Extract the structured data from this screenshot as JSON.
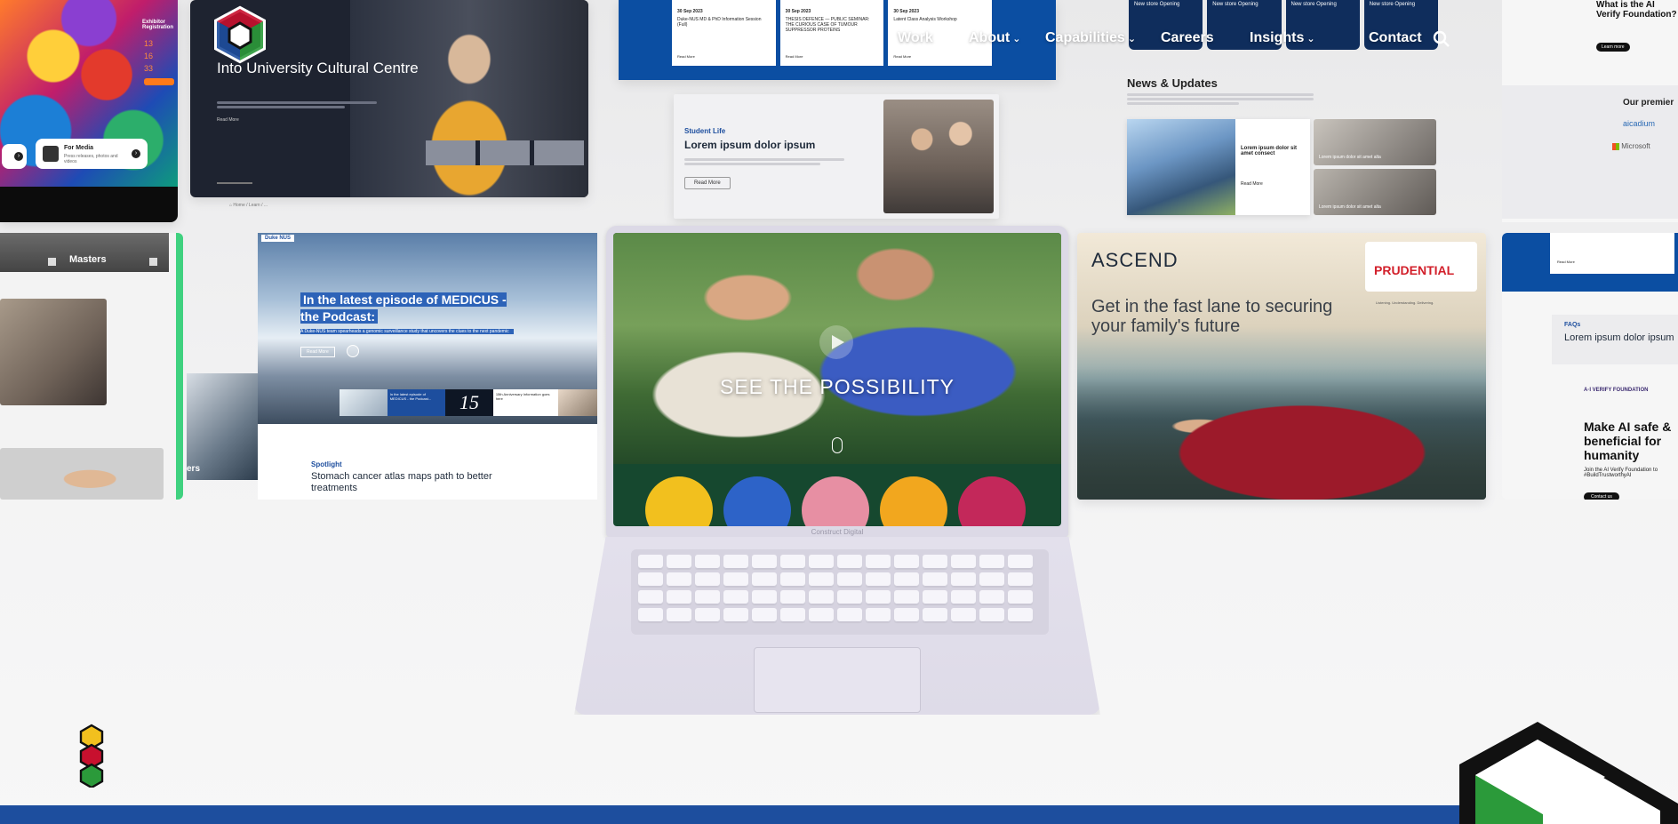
{
  "nav": {
    "items": [
      {
        "label": "Work"
      },
      {
        "label": "About"
      },
      {
        "label": "Capabilities"
      },
      {
        "label": "Careers"
      },
      {
        "label": "Insights"
      },
      {
        "label": "Contact"
      }
    ],
    "search_icon": "search-icon",
    "brand_colors": [
      "#c8102e",
      "#1d4e9e",
      "#2b9a3a",
      "#f2c01e",
      "#111111"
    ]
  },
  "hero": {
    "tagline": "SEE THE POSSIBILITY",
    "laptop_brand": "Construct Digital"
  },
  "tiles": {
    "cultural_centre": {
      "title": "Into University Cultural Centre",
      "read_more": "Read More"
    },
    "festival": {
      "label": "Exhibitor Registration",
      "countdown": [
        "13",
        "16",
        "33"
      ],
      "media_title": "For Media",
      "media_sub": "Press releases, photos and videos"
    },
    "events": {
      "dates": [
        "30 Sep 2023",
        "30 Sep 2023",
        "30 Sep 2023"
      ],
      "titles": [
        "Duke-NUS MD & PhD Information Session (Full)",
        "THESIS DEFENCE — PUBLIC SEMINAR: THE CURIOUS CASE OF TUMOUR SUPPRESSOR PROTEINS",
        "Latent Class Analysis Workshop"
      ],
      "read_more": "Read More"
    },
    "student_life": {
      "eyebrow": "Student Life",
      "title": "Lorem ipsum dolor ipsum",
      "read_more": "Read More"
    },
    "store": {
      "items": [
        "New store Opening",
        "New store Opening",
        "New store Opening",
        "New store Opening"
      ]
    },
    "news": {
      "title": "News & Updates",
      "feature_title": "Lorem ipsum dolor sit amet consect",
      "read_more": "Read More",
      "side_caption": "Lorem ipsum dolor sit amet alta"
    },
    "ai_verify_top": {
      "title": "What is the AI Verify Foundation?",
      "button": "Learn more",
      "premier": "Our premier",
      "partner1": "aicadium",
      "partner2": "Microsoft"
    },
    "masters": {
      "label": "Masters",
      "label2": "ers"
    },
    "medicus": {
      "logo": "Duke NUS",
      "title": "In the latest episode of MEDICUS - the Podcast:",
      "sub": "A Duke-NUS team spearheads a genomic surveillance study that uncovers the clues to the next pandemic",
      "read_more": "Read More",
      "thumb_text": "In the latest episode of MEDICUS - the Podcast...",
      "anniv": "15",
      "anniv_text": "15th Anniversary Information goes here",
      "spotlight": "Spotlight",
      "spotlight_title": "Stomach cancer atlas maps path to better treatments"
    },
    "prudential": {
      "brand": "ASCEND",
      "partner": "PRUDENTIAL",
      "tagline_small": "Listening. Understanding. Delivering.",
      "headline": "Get in the fast lane to securing your family's future"
    },
    "ai_verify": {
      "faq_eyebrow": "FAQs",
      "faq_title": "Lorem ipsum dolor ipsum",
      "logo": "A·I VERIFY FOUNDATION",
      "headline": "Make AI safe & beneficial for humanity",
      "sub": "Join the AI Verify Foundation to #BuildTrustworthyAI",
      "button": "Contact us",
      "read_more": "Read More"
    }
  }
}
